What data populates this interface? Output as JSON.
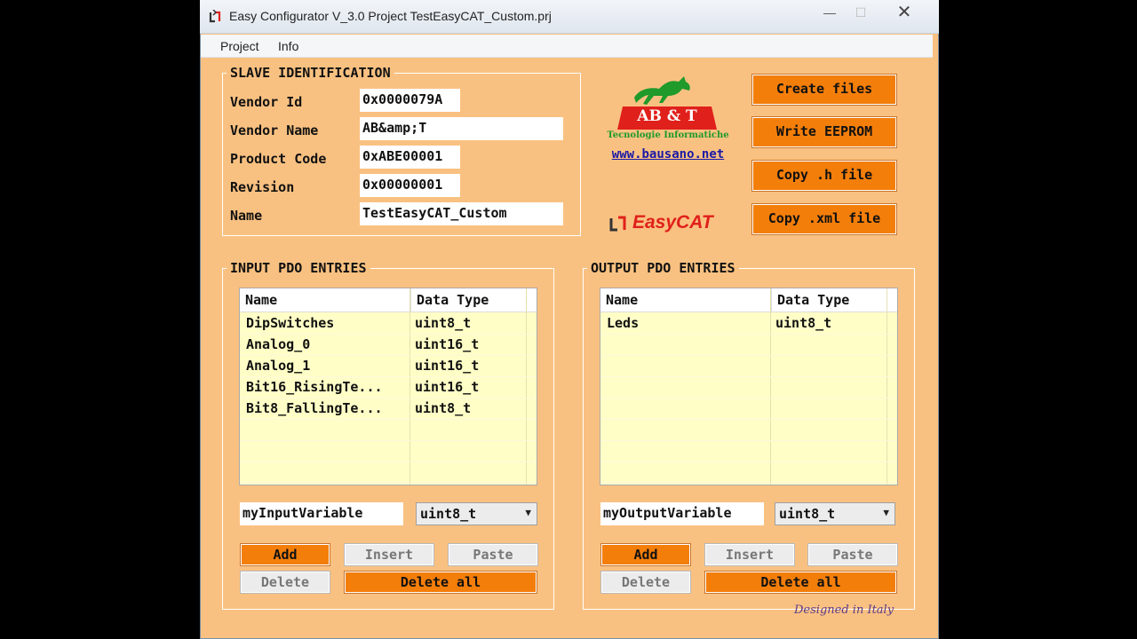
{
  "window": {
    "title": "Easy Configurator V_3.0     Project  TestEasyCAT_Custom.prj",
    "minimize": "—",
    "maximize": "☐",
    "close": "✕"
  },
  "menu": {
    "items": [
      "Project",
      "Info"
    ]
  },
  "slave": {
    "title": "SLAVE IDENTIFICATION",
    "fields": [
      {
        "label": "Vendor Id",
        "value": "0x0000079A"
      },
      {
        "label": "Vendor Name",
        "value": "AB&amp;T"
      },
      {
        "label": "Product Code",
        "value": "0xABE00001"
      },
      {
        "label": "Revision",
        "value": "0x00000001"
      },
      {
        "label": "Name",
        "value": "TestEasyCAT_Custom"
      }
    ]
  },
  "logo": {
    "brand": "AB & T",
    "tagline": "Tecnologie Informatiche",
    "url": "www.bausano.net",
    "product": "EasyCAT",
    "brand_color": "#e0201b",
    "horse_color": "#1f9a2b"
  },
  "actions": {
    "create": "Create files",
    "write": "Write EEPROM",
    "copy_h": "Copy .h file",
    "copy_xml": "Copy .xml file"
  },
  "input_pdo": {
    "title": "INPUT PDO ENTRIES",
    "columns": [
      "Name",
      "Data Type"
    ],
    "rows": [
      [
        "DipSwitches",
        "uint8_t"
      ],
      [
        "Analog_0",
        "uint16_t"
      ],
      [
        "Analog_1",
        "uint16_t"
      ],
      [
        "Bit16_RisingTe...",
        "uint16_t"
      ],
      [
        "Bit8_FallingTe...",
        "uint8_t"
      ]
    ],
    "new_name": "myInputVariable",
    "new_type": "uint8_t",
    "buttons": {
      "add": "Add",
      "insert": "Insert",
      "paste": "Paste",
      "delete": "Delete",
      "delete_all": "Delete all"
    }
  },
  "output_pdo": {
    "title": "OUTPUT PDO ENTRIES",
    "columns": [
      "Name",
      "Data Type"
    ],
    "rows": [
      [
        "Leds",
        "uint8_t"
      ]
    ],
    "new_name": "myOutputVariable",
    "new_type": "uint8_t",
    "buttons": {
      "add": "Add",
      "insert": "Insert",
      "paste": "Paste",
      "delete": "Delete",
      "delete_all": "Delete all"
    }
  },
  "footer": {
    "designed": "Designed in Italy"
  },
  "colors": {
    "background": "#f9c181",
    "accent_button": "#f47e0a",
    "list_bg": "#fffec7"
  }
}
